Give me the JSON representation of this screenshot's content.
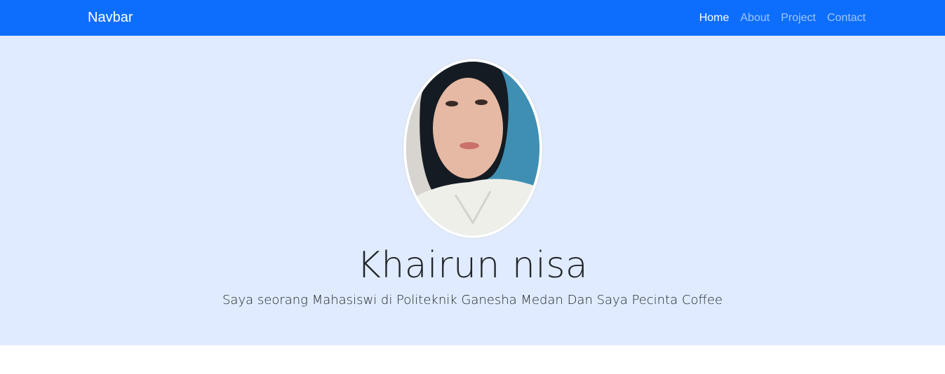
{
  "navbar": {
    "brand": "Navbar",
    "links": [
      {
        "label": "Home",
        "active": true
      },
      {
        "label": "About",
        "active": false
      },
      {
        "label": "Project",
        "active": false
      },
      {
        "label": "Contact",
        "active": false
      }
    ],
    "bg_color": "#0d6efd"
  },
  "hero": {
    "name": "Khairun nisa",
    "tagline": "Saya seorang Mahasiswi di Politeknik Ganesha Medan Dan Saya Pecinta Coffee",
    "bg_color": "#e0ebff",
    "avatar_icon": "profile-photo"
  }
}
